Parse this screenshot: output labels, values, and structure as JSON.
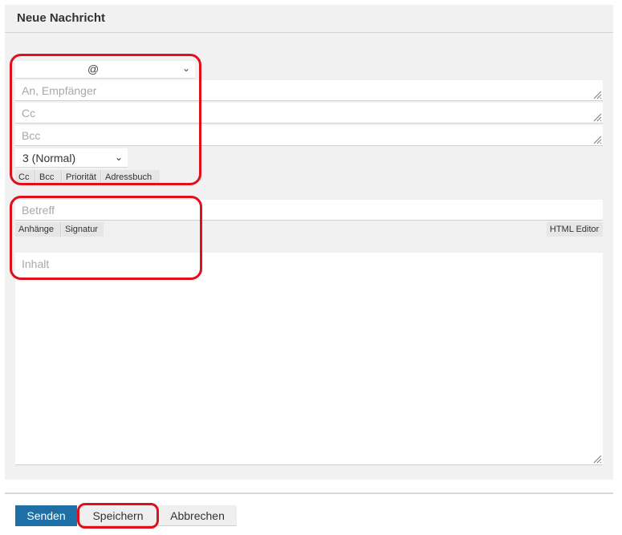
{
  "header": {
    "title": "Neue Nachricht"
  },
  "from": {
    "value": "@"
  },
  "recipients": {
    "to_placeholder": "An, Empfänger",
    "cc_placeholder": "Cc",
    "bcc_placeholder": "Bcc"
  },
  "priority": {
    "value": "3 (Normal)"
  },
  "address_buttons": {
    "cc": "Cc",
    "bcc": "Bcc",
    "priority": "Priorität",
    "addressbook": "Adressbuch"
  },
  "subject": {
    "placeholder": "Betreff"
  },
  "editor_buttons": {
    "attachments": "Anhänge",
    "signature": "Signatur",
    "html_editor": "HTML Editor"
  },
  "content": {
    "placeholder": "Inhalt"
  },
  "footer": {
    "send": "Senden",
    "save": "Speichern",
    "cancel": "Abbrechen"
  },
  "colors": {
    "primary": "#1d6fa5",
    "highlight": "#e0101a",
    "panel": "#f1f1f1"
  }
}
